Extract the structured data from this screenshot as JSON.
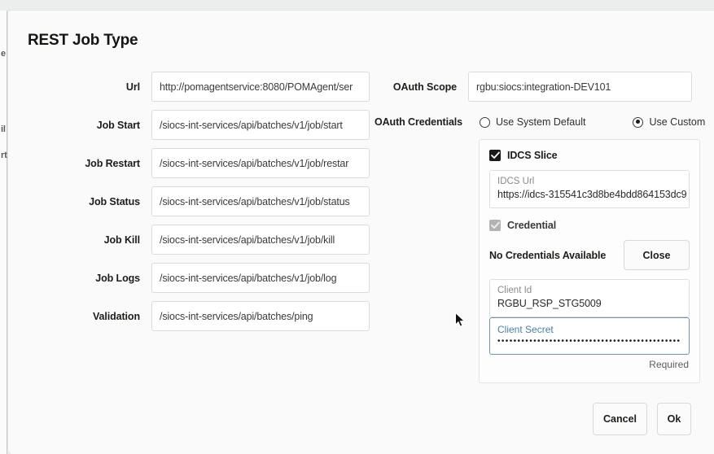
{
  "dialog": {
    "title": "REST Job Type"
  },
  "background": {
    "ghost_fragments": [
      "e",
      "il",
      "rt"
    ]
  },
  "left_form": {
    "fields": [
      {
        "label": "Url",
        "value": "http://pomagentservice:8080/POMAgent/ser"
      },
      {
        "label": "Job Start",
        "value": "/siocs-int-services/api/batches/v1/job/start"
      },
      {
        "label": "Job Restart",
        "value": "/siocs-int-services/api/batches/v1/job/restar"
      },
      {
        "label": "Job Status",
        "value": "/siocs-int-services/api/batches/v1/job/status"
      },
      {
        "label": "Job Kill",
        "value": "/siocs-int-services/api/batches/v1/job/kill"
      },
      {
        "label": "Job Logs",
        "value": "/siocs-int-services/api/batches/v1/job/log"
      },
      {
        "label": "Validation",
        "value": "/siocs-int-services/api/batches/ping"
      }
    ]
  },
  "right_form": {
    "oauth_scope": {
      "label": "OAuth Scope",
      "value": "rgbu:siocs:integration-DEV101"
    },
    "oauth_credentials": {
      "label": "OAuth Credentials",
      "options": [
        {
          "label": "Use System Default",
          "selected": false
        },
        {
          "label": "Use Custom",
          "selected": true
        }
      ]
    }
  },
  "credentials_panel": {
    "idcs_slice": {
      "label": "IDCS Slice",
      "checked": true
    },
    "idcs_url": {
      "label": "IDCS Url",
      "value": "https://idcs-315541c3d8be4bdd864153dc9"
    },
    "credential": {
      "label": "Credential",
      "checked": true,
      "disabled": true
    },
    "no_credentials_text": "No Credentials Available",
    "close_label": "Close",
    "client_id": {
      "label": "Client Id",
      "value": "RGBU_RSP_STG5009"
    },
    "client_secret": {
      "label": "Client Secret",
      "value": "•••••••••••••••••••••••••••••••••••••••••••••••••",
      "helper": "Required"
    }
  },
  "footer": {
    "cancel_label": "Cancel",
    "ok_label": "Ok"
  },
  "colors": {
    "accent_focus": "#4a7fa5",
    "border_focus": "#7394ad",
    "text_primary": "#1d1d1b",
    "panel_bg": "#fdfdfd",
    "modal_bg": "#fafafa"
  }
}
